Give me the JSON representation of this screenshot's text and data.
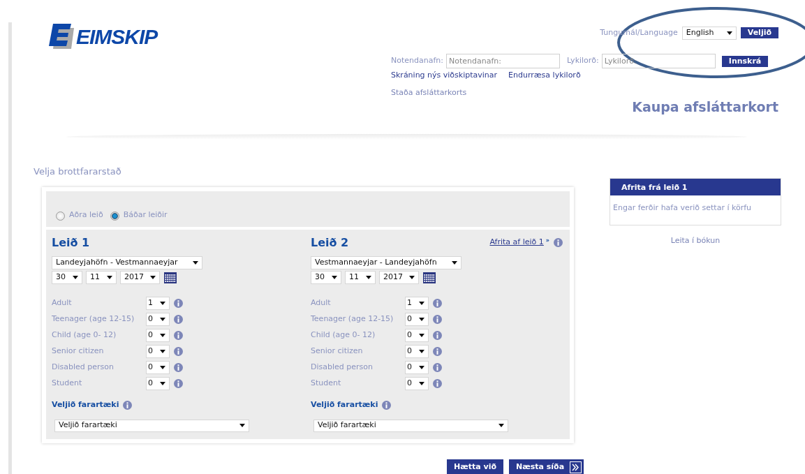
{
  "header": {
    "logo": "EIMSKIP",
    "language_label": "Tungumál/Language",
    "language_value": "English",
    "language_button": "Veljið",
    "username_label": "Notendanafn:",
    "username_placeholder": "Notendanafn:",
    "password_label": "Lykilorð:",
    "password_placeholder": "Lykilorð:",
    "login_button": "Innskrá",
    "links": [
      "Skráning nýs viðskiptavinar",
      "Endurræsa lykilorð"
    ],
    "card_status_link": "Staða afsláttarkorts",
    "page_title": "Kaupa afsláttarkort"
  },
  "section_title": "Velja brottfararstað",
  "trip_type": [
    {
      "label": "Aðra leið",
      "selected": false
    },
    {
      "label": "Báðar leiðir",
      "selected": true
    }
  ],
  "legs": [
    {
      "title": "Leið 1",
      "route": "Landeyjahöfn - Vestmannaeyjar",
      "day": "30",
      "month": "11",
      "year": "2017",
      "passengers": [
        {
          "label": "Adult",
          "count": "1"
        },
        {
          "label": "Teenager (age 12-15)",
          "count": "0"
        },
        {
          "label": "Child (age 0- 12)",
          "count": "0"
        },
        {
          "label": "Senior citizen",
          "count": "0"
        },
        {
          "label": "Disabled person",
          "count": "0"
        },
        {
          "label": "Student",
          "count": "0"
        }
      ],
      "vehicle_label": "Veljið farartæki",
      "vehicle_value": "Veljið farartæki"
    },
    {
      "title": "Leið 2",
      "copy_link": "Afrita af leið 1",
      "copy_mark": "»",
      "route": "Vestmannaeyjar - Landeyjahöfn",
      "day": "30",
      "month": "11",
      "year": "2017",
      "passengers": [
        {
          "label": "Adult",
          "count": "1"
        },
        {
          "label": "Teenager (age 12-15)",
          "count": "0"
        },
        {
          "label": "Child (age 0- 12)",
          "count": "0"
        },
        {
          "label": "Senior citizen",
          "count": "0"
        },
        {
          "label": "Disabled person",
          "count": "0"
        },
        {
          "label": "Student",
          "count": "0"
        }
      ],
      "vehicle_label": "Veljið farartæki",
      "vehicle_value": "Veljið farartæki"
    }
  ],
  "sidebar": {
    "header": "Afrita frá leið 1",
    "message": "Engar ferðir hafa verið settar í körfu",
    "search_link": "Leita í bókun"
  },
  "buttons": {
    "cancel": "Hætta við",
    "next": "Næsta síða"
  }
}
